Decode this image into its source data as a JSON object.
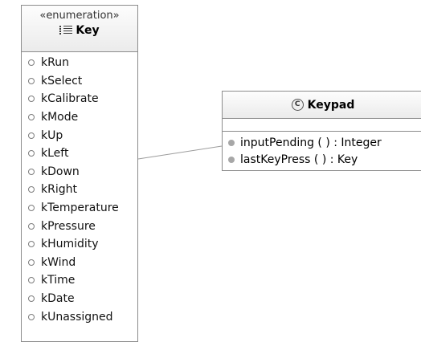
{
  "enumeration": {
    "stereotype": "«enumeration»",
    "name": "Key",
    "icon": "enumeration-icon",
    "literals": [
      "kRun",
      "kSelect",
      "kCalibrate",
      "kMode",
      "kUp",
      "kLeft",
      "kDown",
      "kRight",
      "kTemperature",
      "kPressure",
      "kHumidity",
      "kWind",
      "kTime",
      "kDate",
      "kUnassigned"
    ]
  },
  "keypad_class": {
    "name": "Keypad",
    "icon": "class-icon",
    "icon_glyph": "C",
    "operations": [
      "inputPending ( ) : Integer",
      "lastKeyPress ( ) : Key"
    ]
  },
  "colors": {
    "border": "#8c8c8c",
    "connector": "#9c9c9c",
    "operation_dot": "#a7a7a7"
  }
}
